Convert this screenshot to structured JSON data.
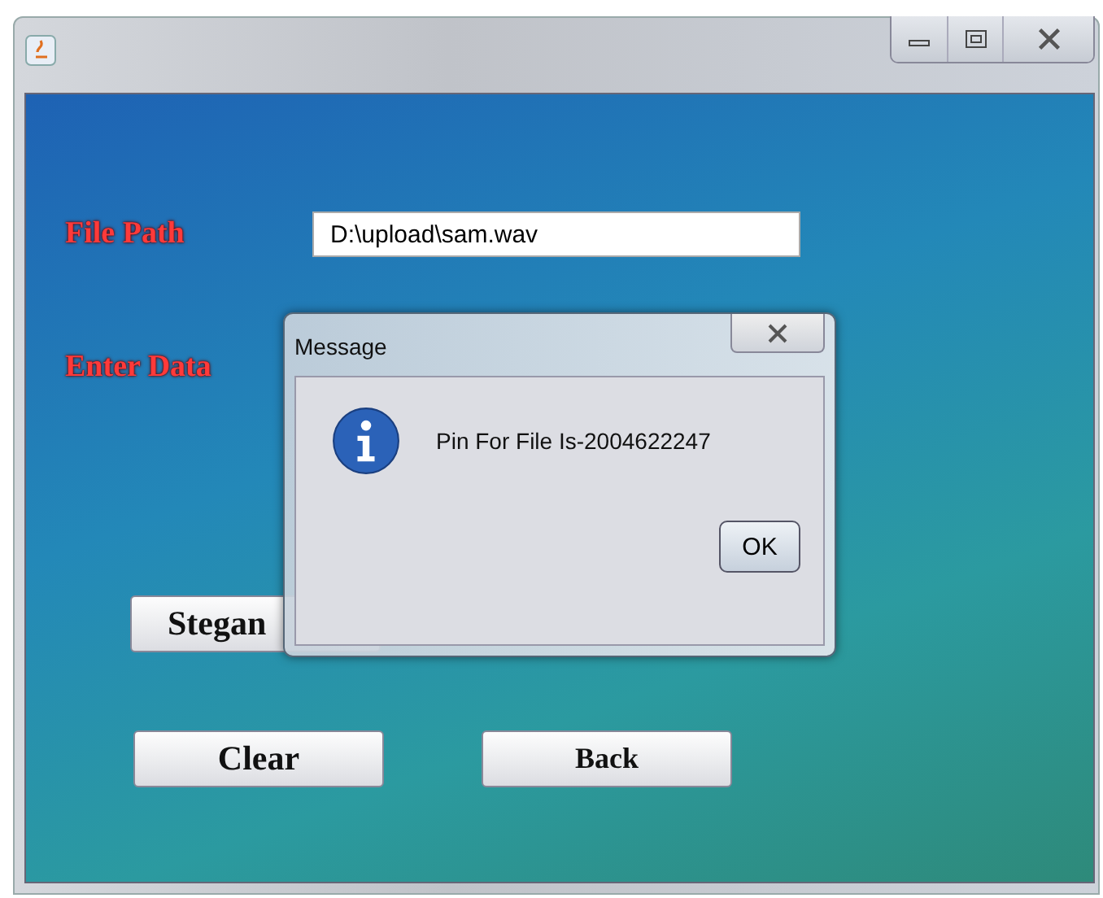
{
  "window": {
    "controls": [
      {
        "kind": "minimize"
      },
      {
        "kind": "maximize"
      },
      {
        "kind": "close"
      }
    ]
  },
  "form": {
    "fields": [
      {
        "label": "File Path",
        "value": "D:\\upload\\sam.wav",
        "kind": "input"
      },
      {
        "label": "Enter Data",
        "kind": "none"
      }
    ],
    "buttons": [
      "Stegan",
      "Clear",
      "Back"
    ]
  },
  "dialog": {
    "title": "Message",
    "message": "Pin For File Is-2004622247",
    "button": "OK"
  }
}
